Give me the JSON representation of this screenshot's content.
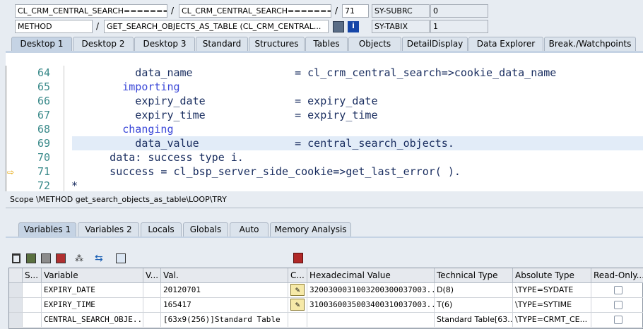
{
  "top": {
    "row1": {
      "field1": "CL_CRM_CENTRAL_SEARCH=========",
      "sep1": "/",
      "field2": "CL_CRM_CENTRAL_SEARCH=========",
      "sep2": "/",
      "line": "71",
      "sys1": "SY-SUBRC",
      "val1": "0"
    },
    "row2": {
      "field1": "METHOD",
      "sep1": "/",
      "field2": "GET_SEARCH_OBJECTS_AS_TABLE (CL_CRM_CENTRAL...",
      "sys2": "SY-TABIX",
      "val2": "1"
    }
  },
  "desk_tabs": [
    "Desktop 1",
    "Desktop 2",
    "Desktop 3",
    "Standard",
    "Structures",
    "Tables",
    "Objects",
    "DetailDisplay",
    "Data Explorer",
    "Break./Watchpoints"
  ],
  "code": {
    "lines": [
      {
        "n": "64",
        "parts": [
          {
            "t": "          data_name                = ",
            "c": ""
          },
          {
            "t": "cl_crm_central_search=>cookie_data_name",
            "c": ""
          }
        ]
      },
      {
        "n": "65",
        "parts": [
          {
            "t": "        importing",
            "c": "kw"
          }
        ]
      },
      {
        "n": "66",
        "parts": [
          {
            "t": "          expiry_date              = expiry_date",
            "c": ""
          }
        ]
      },
      {
        "n": "67",
        "parts": [
          {
            "t": "          expiry_time              = expiry_time",
            "c": ""
          }
        ]
      },
      {
        "n": "68",
        "parts": [
          {
            "t": "        changing",
            "c": "kw"
          }
        ]
      },
      {
        "n": "69",
        "parts": [
          {
            "t": "          data_value               = central_search_objects.",
            "c": ""
          }
        ]
      },
      {
        "n": "70",
        "parts": [
          {
            "t": "      data: success type i.",
            "c": ""
          }
        ]
      },
      {
        "n": "71",
        "parts": [
          {
            "t": "      success = cl_bsp_server_side_cookie=>get_last_error( ).",
            "c": ""
          }
        ]
      },
      {
        "n": "72",
        "parts": [
          {
            "t": "*",
            "c": ""
          }
        ]
      }
    ]
  },
  "scope": "Scope \\METHOD get_search_objects_as_table\\LOOP\\TRY",
  "var_tabs": [
    "Variables 1",
    "Variables 2",
    "Locals",
    "Globals",
    "Auto",
    "Memory Analysis"
  ],
  "grid": {
    "headers": [
      "S...",
      "Variable",
      "V...",
      "Val.",
      "C...",
      "Hexadecimal Value",
      "Technical Type",
      "Absolute Type",
      "Read-Only..."
    ],
    "rows": [
      {
        "variable": "EXPIRY_DATE",
        "value": "20120701",
        "hex": "3200300031003200300037003...",
        "tech": "D(8)",
        "abs": "\\TYPE=SYDATE"
      },
      {
        "variable": "EXPIRY_TIME",
        "value": "165417",
        "hex": "3100360035003400310037003...",
        "tech": "T(6)",
        "abs": "\\TYPE=SYTIME"
      },
      {
        "variable": "CENTRAL_SEARCH_OBJE...",
        "value": "[63x9(256)]Standard Table",
        "hex": "",
        "tech": "Standard Table[63...",
        "abs": "\\TYPE=CRMT_CE..."
      }
    ]
  },
  "colors": {
    "accent": "#c5d3e4",
    "keyword": "#3a47d8",
    "linenum": "#3a8a8a"
  }
}
